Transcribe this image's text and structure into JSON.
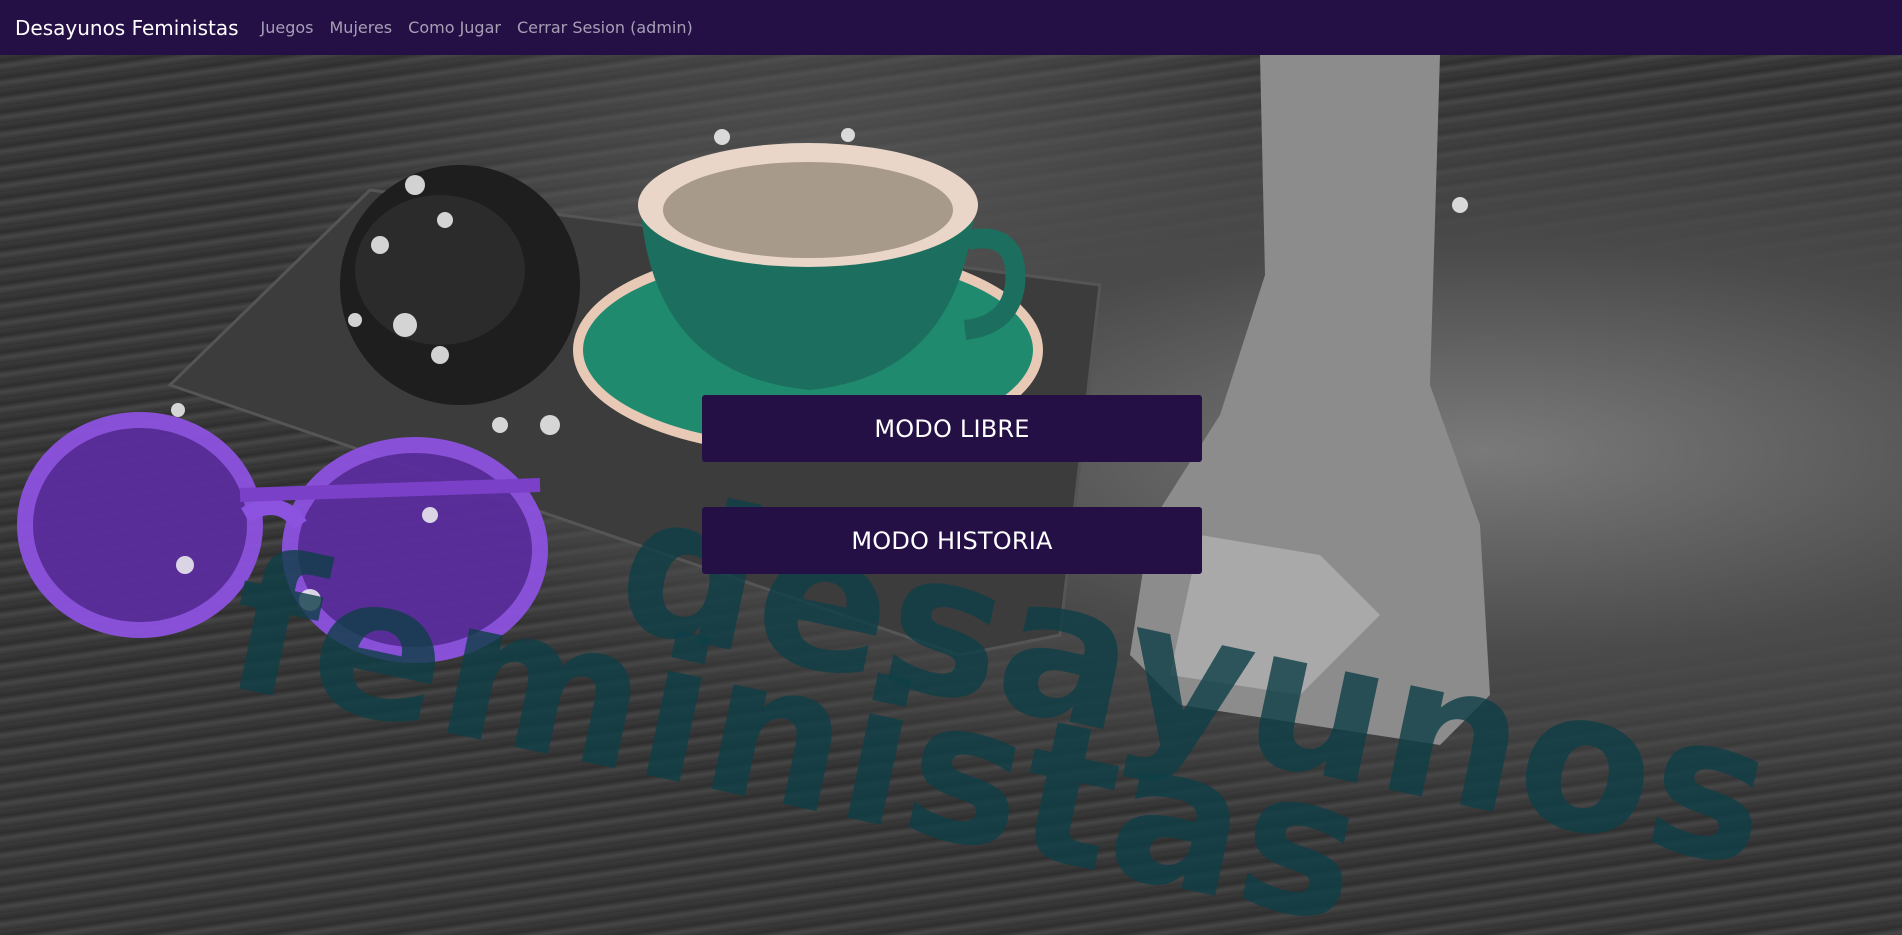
{
  "navbar": {
    "brand": "Desayunos Feministas",
    "links": [
      "Juegos",
      "Mujeres",
      "Como Jugar",
      "Cerrar Sesion (admin)"
    ]
  },
  "main": {
    "buttons": {
      "libre": "MODO LIBRE",
      "historia": "MODO HISTORIA"
    },
    "background_text": {
      "line1": "desayunos",
      "line2": "feministas"
    }
  },
  "colors": {
    "navbar_bg": "#251046",
    "button_bg": "#251046",
    "watermark_text": "#0f3f47",
    "cup_green": "#1f8a6e",
    "glasses_purple": "#7a40c8"
  }
}
